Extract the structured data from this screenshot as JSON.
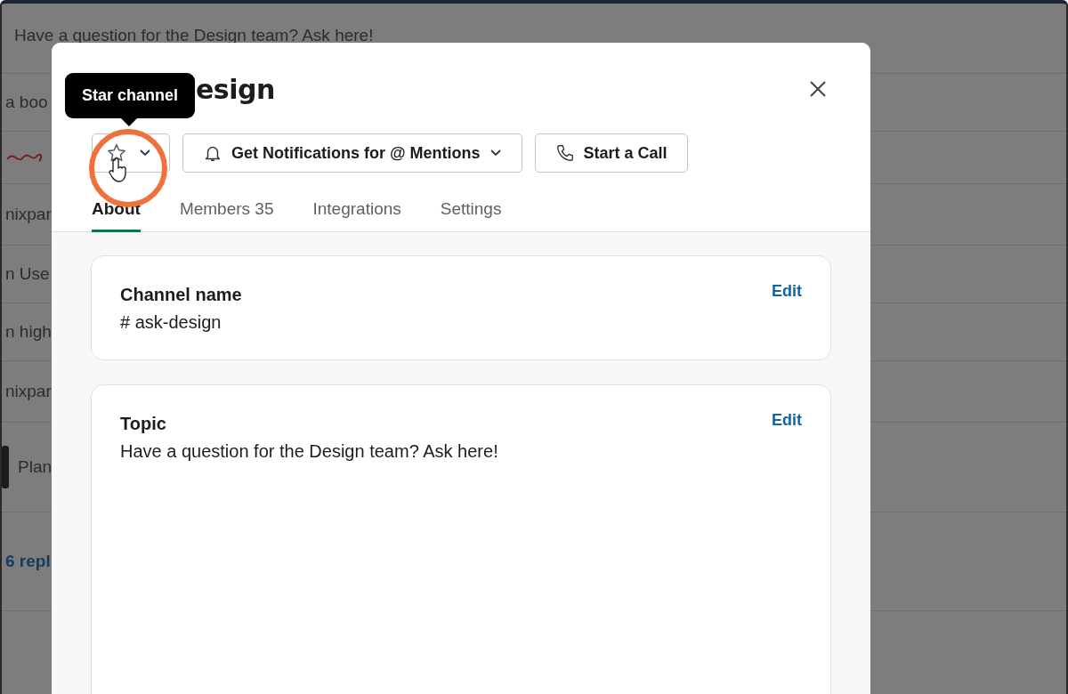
{
  "background": {
    "header_text": "Have a question for the Design team? Ask here!",
    "fragments": [
      {
        "kind": "text",
        "text": "a boo"
      },
      {
        "kind": "scribble"
      },
      {
        "kind": "text",
        "text": "nixpar"
      },
      {
        "kind": "text",
        "text": "n Use"
      },
      {
        "kind": "text",
        "text": "n high"
      },
      {
        "kind": "text",
        "text": "nixpar"
      },
      {
        "kind": "block",
        "text": "Plan"
      },
      {
        "kind": "link",
        "text": "6 repl"
      }
    ]
  },
  "modal": {
    "title": "esign",
    "tooltip": "Star channel",
    "star_button": {
      "starred": false
    },
    "buttons": [
      {
        "kind": "bell",
        "label": "Get Notifications for @ Mentions",
        "dropdown": true
      },
      {
        "kind": "phone",
        "label": "Start a Call",
        "dropdown": false
      }
    ],
    "tabs": [
      {
        "label": "About",
        "selected": true
      },
      {
        "label": "Members",
        "count": "35",
        "selected": false
      },
      {
        "label": "Integrations",
        "selected": false
      },
      {
        "label": "Settings",
        "selected": false
      }
    ],
    "cards": [
      {
        "label": "Channel name",
        "value": "# ask-design",
        "action": "Edit"
      },
      {
        "label": "Topic",
        "value": "Have a question for the Design team? Ask here!",
        "action": "Edit"
      }
    ]
  }
}
